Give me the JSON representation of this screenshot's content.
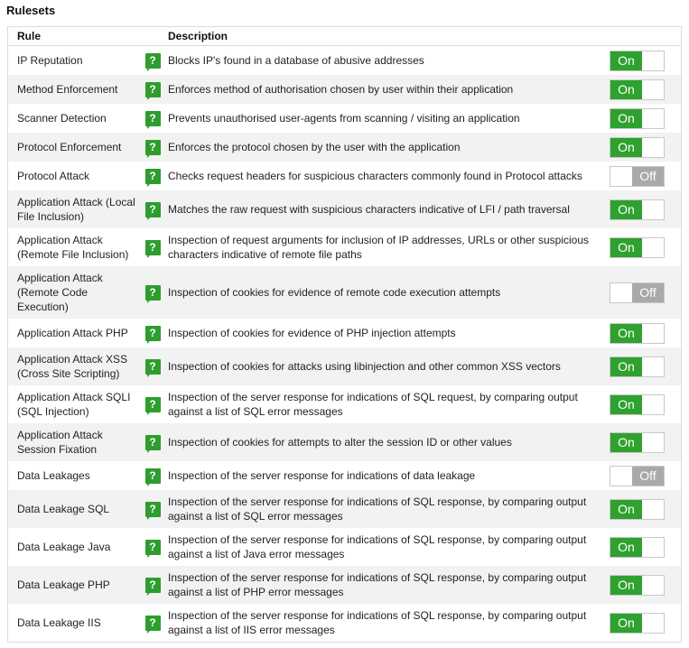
{
  "title": "Rulesets",
  "headers": {
    "rule": "Rule",
    "description": "Description"
  },
  "toggle_labels": {
    "on": "On",
    "off": "Off"
  },
  "help_glyph": "?",
  "colors": {
    "on": "#2ea12e",
    "off": "#a9a9a9",
    "help": "#2e9d2e"
  },
  "rules": [
    {
      "name": "IP Reputation",
      "description": "Blocks IP's found in a database of abusive addresses",
      "state": "on"
    },
    {
      "name": "Method Enforcement",
      "description": "Enforces method of authorisation chosen by user within their application",
      "state": "on"
    },
    {
      "name": "Scanner Detection",
      "description": "Prevents unauthorised user-agents from scanning / visiting an application",
      "state": "on"
    },
    {
      "name": "Protocol Enforcement",
      "description": "Enforces the protocol chosen by the user with the application",
      "state": "on"
    },
    {
      "name": "Protocol Attack",
      "description": "Checks request headers for suspicious characters commonly found in Protocol attacks",
      "state": "off"
    },
    {
      "name": "Application Attack (Local File Inclusion)",
      "description": "Matches the raw request with suspicious characters indicative of LFI / path traversal",
      "state": "on"
    },
    {
      "name": "Application Attack (Remote File Inclusion)",
      "description": "Inspection of request arguments for inclusion of IP addresses, URLs or other suspicious characters indicative of remote file paths",
      "state": "on"
    },
    {
      "name": "Application Attack (Remote Code Execution)",
      "description": "Inspection of cookies for evidence of remote code execution attempts",
      "state": "off"
    },
    {
      "name": "Application Attack PHP",
      "description": "Inspection of cookies for evidence of PHP injection attempts",
      "state": "on"
    },
    {
      "name": "Application Attack XSS (Cross Site Scripting)",
      "description": "Inspection of cookies for attacks using libinjection and other common XSS vectors",
      "state": "on"
    },
    {
      "name": "Application Attack SQLI (SQL Injection)",
      "description": "Inspection of the server response for indications of SQL request, by comparing output against a list of SQL error messages",
      "state": "on"
    },
    {
      "name": "Application Attack Session Fixation",
      "description": "Inspection of cookies for attempts to alter the session ID or other values",
      "state": "on"
    },
    {
      "name": "Data Leakages",
      "description": "Inspection of the server response for indications of data leakage",
      "state": "off"
    },
    {
      "name": "Data Leakage SQL",
      "description": "Inspection of the server response for indications of SQL response, by comparing output against a list of SQL error messages",
      "state": "on"
    },
    {
      "name": "Data Leakage Java",
      "description": "Inspection of the server response for indications of SQL response, by comparing output against a list of Java error messages",
      "state": "on"
    },
    {
      "name": "Data Leakage PHP",
      "description": "Inspection of the server response for indications of SQL response, by comparing output against a list of PHP error messages",
      "state": "on"
    },
    {
      "name": "Data Leakage IIS",
      "description": "Inspection of the server response for indications of SQL response, by comparing output against a list of IIS error messages",
      "state": "on"
    }
  ]
}
